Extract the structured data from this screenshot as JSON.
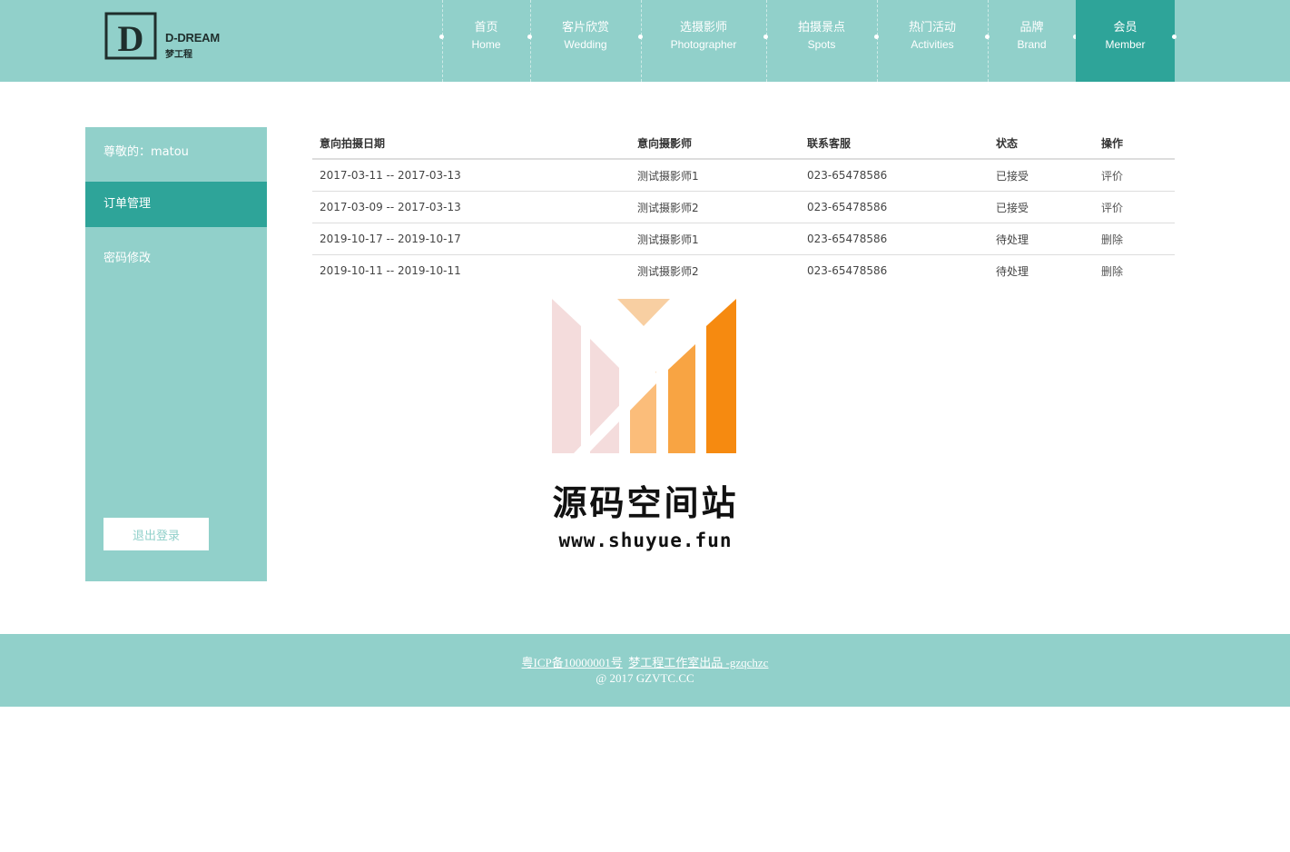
{
  "brand": {
    "name_en": "D-DREAM",
    "name_cn": "梦工程",
    "logo_letter": "D"
  },
  "nav": {
    "items": [
      {
        "cn": "首页",
        "en": "Home",
        "active": false
      },
      {
        "cn": "客片欣赏",
        "en": "Wedding",
        "active": false
      },
      {
        "cn": "选摄影师",
        "en": "Photographer",
        "active": false
      },
      {
        "cn": "拍摄景点",
        "en": "Spots",
        "active": false
      },
      {
        "cn": "热门活动",
        "en": "Activities",
        "active": false
      },
      {
        "cn": "品牌",
        "en": "Brand",
        "active": false
      },
      {
        "cn": "会员",
        "en": "Member",
        "active": true
      }
    ]
  },
  "sidebar": {
    "greeting": "尊敬的：matou",
    "items": [
      {
        "label": "订单管理",
        "active": true
      },
      {
        "label": "密码修改",
        "active": false
      }
    ],
    "logout_label": "退出登录"
  },
  "orders": {
    "headers": [
      "意向拍摄日期",
      "意向摄影师",
      "联系客服",
      "状态",
      "操作"
    ],
    "rows": [
      {
        "date": "2017-03-11 -- 2017-03-13",
        "photographer": "测试摄影师1",
        "phone": "023-65478586",
        "status": "已接受",
        "action": "评价"
      },
      {
        "date": "2017-03-09 -- 2017-03-13",
        "photographer": "测试摄影师2",
        "phone": "023-65478586",
        "status": "已接受",
        "action": "评价"
      },
      {
        "date": "2019-10-17 -- 2019-10-17",
        "photographer": "测试摄影师1",
        "phone": "023-65478586",
        "status": "待处理",
        "action": "删除"
      },
      {
        "date": "2019-10-11 -- 2019-10-11",
        "photographer": "测试摄影师2",
        "phone": "023-65478586",
        "status": "待处理",
        "action": "删除"
      }
    ]
  },
  "watermark": {
    "title": "源码空间站",
    "url": "www.shuyue.fun",
    "logo_icon": "chart-m-logo"
  },
  "footer": {
    "icp": "粤ICP备10000001号",
    "studio": "梦工程工作室出品 -gzqchzc",
    "copyright": "@ 2017 GZVTC.CC"
  },
  "colors": {
    "primary": "#91d0ca",
    "accent": "#2ea499",
    "text": "#333333"
  }
}
